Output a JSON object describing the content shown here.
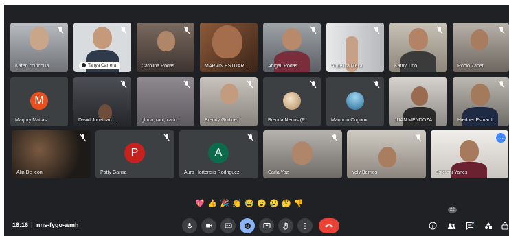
{
  "meeting": {
    "time": "16:16",
    "separator": "|",
    "code": "nns-fygo-wmh",
    "participant_count": "22"
  },
  "participants": {
    "karen": "Karen chinchilla",
    "tanya": "Tanya Carrera",
    "carolina": "Carolina Rodas",
    "marvin": "MARVIN ESTUAR...",
    "abigail": "Abigail Rodas",
    "angelica": "Angelica Mejia",
    "kathy": "Kathy Tiño",
    "rocio": "Rocio Zapet",
    "marjory": "Marjory Matias",
    "david": "David Jonathan ...",
    "gloria": "gloria, raul, carlo...",
    "brendy": "Brendy Godinez",
    "brenda": "Brenda Nerios (R...",
    "mauricio": "Mauricio Coguox",
    "juan": "JUAN MENDOZA",
    "hiedner": "Hiedner Estuard...",
    "alin": "Alin De leon",
    "patty": "Patty Garcia",
    "aura": "Aura Hortensia Rodriguez",
    "carla": "Carla Yaz",
    "yoly": "Yoly Barrios",
    "estefani": "Estefani Yanes"
  },
  "avatars": {
    "marjory": "M",
    "patty": "P",
    "aura": "A"
  },
  "colors": {
    "background": "#202124",
    "tile": "#3c4043",
    "marjory": "#e8501f",
    "patty": "#c5221f",
    "aura": "#0b6b4a",
    "end_call": "#ea4335",
    "accent": "#8ab4f8"
  },
  "reactions": [
    "💖",
    "👍",
    "🎉",
    "👏",
    "😂",
    "😮",
    "😢",
    "🤔",
    "👎"
  ],
  "icons": [
    "mic-icon",
    "camera-icon",
    "captions-icon",
    "emoji-icon",
    "present-icon",
    "raise-hand-icon",
    "more-icon",
    "end-call-icon",
    "info-icon",
    "people-icon",
    "chat-icon",
    "activities-icon",
    "host-controls-icon"
  ]
}
